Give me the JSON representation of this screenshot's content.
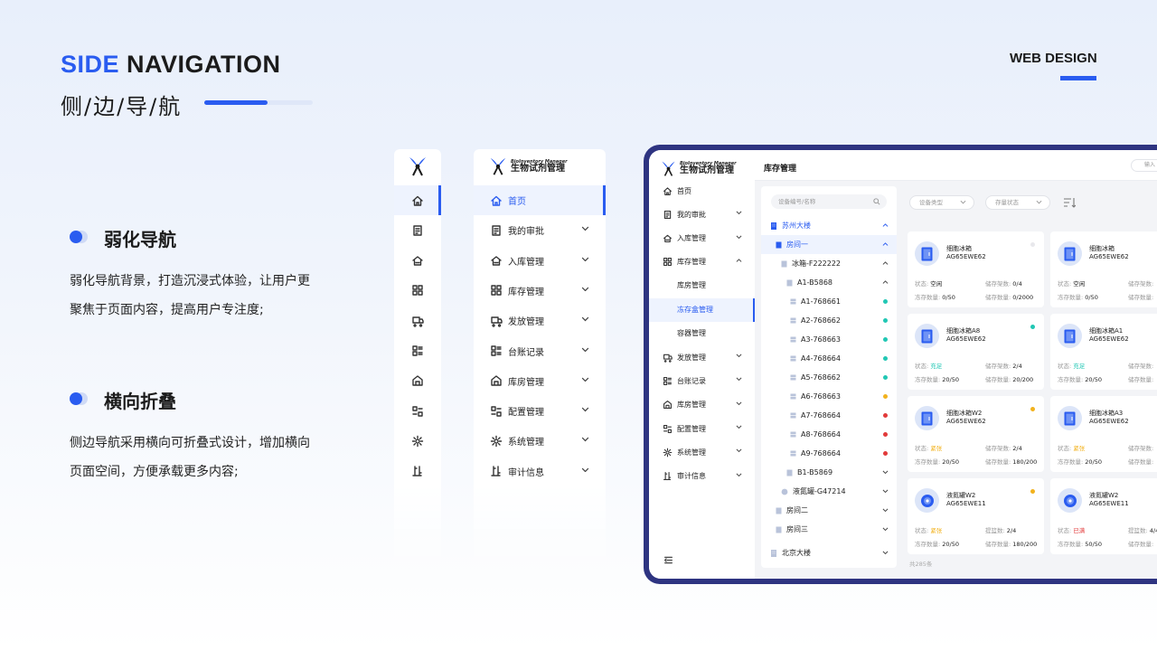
{
  "header": {
    "title_accent": "SIDE",
    "title_rest": "NAVIGATION",
    "subtitle": "侧/边/导/航",
    "tag": "WEB DESIGN"
  },
  "sections": [
    {
      "heading": "弱化导航",
      "lines": [
        "弱化导航背景，打造沉浸式体验，让用户更",
        "聚焦于页面内容，提高用户专注度;"
      ]
    },
    {
      "heading": "横向折叠",
      "lines": [
        "侧边导航采用横向可折叠式设计，增加横向",
        "页面空间，方便承载更多内容;"
      ]
    }
  ],
  "brand": {
    "en": "BioInventory Manager",
    "cn": "生物试剂管理"
  },
  "nav_items": [
    {
      "label": "首页",
      "icon": "home-icon"
    },
    {
      "label": "我的审批",
      "icon": "approval-icon"
    },
    {
      "label": "入库管理",
      "icon": "inbound-icon"
    },
    {
      "label": "库存管理",
      "icon": "inventory-icon"
    },
    {
      "label": "发放管理",
      "icon": "dispatch-icon"
    },
    {
      "label": "台账记录",
      "icon": "ledger-icon"
    },
    {
      "label": "库房管理",
      "icon": "warehouse-icon"
    },
    {
      "label": "配置管理",
      "icon": "config-icon"
    },
    {
      "label": "系统管理",
      "icon": "gear-icon"
    },
    {
      "label": "审计信息",
      "icon": "audit-icon"
    }
  ],
  "inventory_sub": [
    "库房管理",
    "冻存盒管理",
    "容器管理"
  ],
  "device": {
    "page_title": "库存管理",
    "search_top_placeholder": "输入",
    "tree_search_placeholder": "设备编号/名称",
    "filter_type": "设备类型",
    "filter_state": "存量状态",
    "total": "共285条"
  },
  "tree": {
    "building1": "苏州大楼",
    "room1": "房间一",
    "fridge": "冰箱-F222222",
    "rack_a1": "A1-B5868",
    "boxes": [
      {
        "label": "A1-768661",
        "color": "#21c7b4"
      },
      {
        "label": "A2-768662",
        "color": "#21c7b4"
      },
      {
        "label": "A3-768663",
        "color": "#21c7b4"
      },
      {
        "label": "A4-768664",
        "color": "#21c7b4"
      },
      {
        "label": "A5-768662",
        "color": "#21c7b4"
      },
      {
        "label": "A6-768663",
        "color": "#f2b21e"
      },
      {
        "label": "A7-768664",
        "color": "#e23a3a"
      },
      {
        "label": "A8-768664",
        "color": "#e23a3a"
      },
      {
        "label": "A9-768664",
        "color": "#e23a3a"
      }
    ],
    "rack_b1": "B1-B5869",
    "tank": "液氮罐-G47214",
    "room2": "房间二",
    "room3": "房间三",
    "building2": "北京大楼"
  },
  "cards": [
    {
      "name": "细胞冰箱",
      "code": "AG65EWE62",
      "kind": "fridge",
      "dot": "#e8e8ec",
      "k1": "状态:",
      "v1": "空闲",
      "v1c": "#222222",
      "k2": "冻存数量:",
      "v2": "0/50",
      "k3": "储存架数:",
      "v3": "0/4",
      "k4": "储存数量:",
      "v4": "0/2000"
    },
    {
      "name": "细胞冰箱",
      "code": "AG65EWE62",
      "kind": "fridge",
      "dot": "#e8e8ec",
      "k1": "状态:",
      "v1": "空闲",
      "v1c": "#222222",
      "k2": "冻存数量:",
      "v2": "0/50",
      "k3": "储存架数:",
      "v3": "",
      "k4": "储存数量:",
      "v4": ""
    },
    {
      "name": "细胞冰箱A8",
      "code": "AG65EWE62",
      "kind": "fridge",
      "dot": "#21c7b4",
      "k1": "状态:",
      "v1": "充足",
      "v1c": "#21c7b4",
      "k2": "冻存数量:",
      "v2": "20/50",
      "k3": "储存架数:",
      "v3": "2/4",
      "k4": "储存数量:",
      "v4": "20/200"
    },
    {
      "name": "细胞冰箱A1",
      "code": "AG65EWE62",
      "kind": "fridge",
      "dot": "",
      "k1": "状态:",
      "v1": "充足",
      "v1c": "#21c7b4",
      "k2": "冻存数量:",
      "v2": "20/50",
      "k3": "储存架数:",
      "v3": "",
      "k4": "储存数量:",
      "v4": ""
    },
    {
      "name": "细胞冰箱W2",
      "code": "AG65EWE62",
      "kind": "fridge",
      "dot": "#f2b21e",
      "k1": "状态:",
      "v1": "紧张",
      "v1c": "#f2b21e",
      "k2": "冻存数量:",
      "v2": "20/50",
      "k3": "储存架数:",
      "v3": "2/4",
      "k4": "储存数量:",
      "v4": "180/200"
    },
    {
      "name": "细胞冰箱A3",
      "code": "AG65EWE62",
      "kind": "fridge",
      "dot": "",
      "k1": "状态:",
      "v1": "紧张",
      "v1c": "#f2b21e",
      "k2": "冻存数量:",
      "v2": "20/50",
      "k3": "储存架数:",
      "v3": "",
      "k4": "储存数量:",
      "v4": ""
    },
    {
      "name": "液氮罐W2",
      "code": "AG65EWE11",
      "kind": "tank",
      "dot": "#f2b21e",
      "k1": "状态:",
      "v1": "紧张",
      "v1c": "#f2b21e",
      "k2": "冻存数量:",
      "v2": "20/50",
      "k3": "提篮数:",
      "v3": "2/4",
      "k4": "储存数量:",
      "v4": "180/200"
    },
    {
      "name": "液氮罐W2",
      "code": "AG65EWE11",
      "kind": "tank",
      "dot": "",
      "k1": "状态:",
      "v1": "已满",
      "v1c": "#e23a3a",
      "k2": "冻存数量:",
      "v2": "50/50",
      "k3": "提篮数:",
      "v3": "4/4",
      "k4": "储存数量:",
      "v4": ""
    }
  ]
}
